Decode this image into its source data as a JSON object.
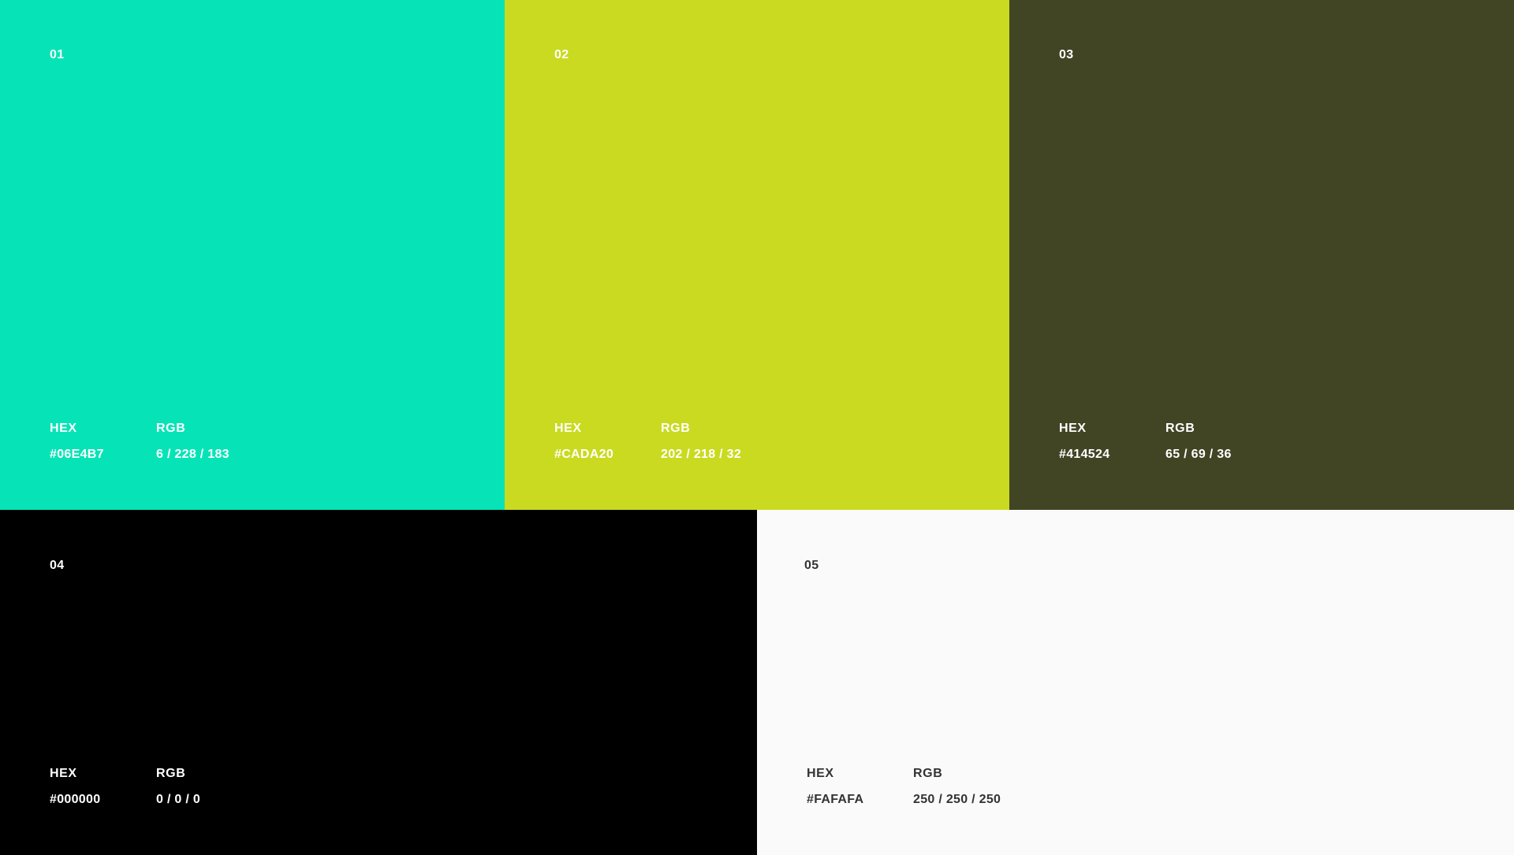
{
  "swatches": [
    {
      "number": "01",
      "color": "#06E4B7",
      "text_color": "#FFFFFF",
      "hex_label": "HEX",
      "hex_value": "#06E4B7",
      "rgb_label": "RGB",
      "rgb_value": "6 / 228 / 183"
    },
    {
      "number": "02",
      "color": "#CADA20",
      "text_color": "#FFFFFF",
      "hex_label": "HEX",
      "hex_value": "#CADA20",
      "rgb_label": "RGB",
      "rgb_value": "202 / 218 / 32"
    },
    {
      "number": "03",
      "color": "#414524",
      "text_color": "#FFFFFF",
      "hex_label": "HEX",
      "hex_value": "#414524",
      "rgb_label": "RGB",
      "rgb_value": "65 / 69 / 36"
    },
    {
      "number": "04",
      "color": "#000000",
      "text_color": "#FFFFFF",
      "hex_label": "HEX",
      "hex_value": "#000000",
      "rgb_label": "RGB",
      "rgb_value": "0 / 0 / 0"
    },
    {
      "number": "05",
      "color": "#FAFAFA",
      "text_color": "#333333",
      "hex_label": "HEX",
      "hex_value": "#FAFAFA",
      "rgb_label": "RGB",
      "rgb_value": "250 / 250 / 250"
    }
  ]
}
